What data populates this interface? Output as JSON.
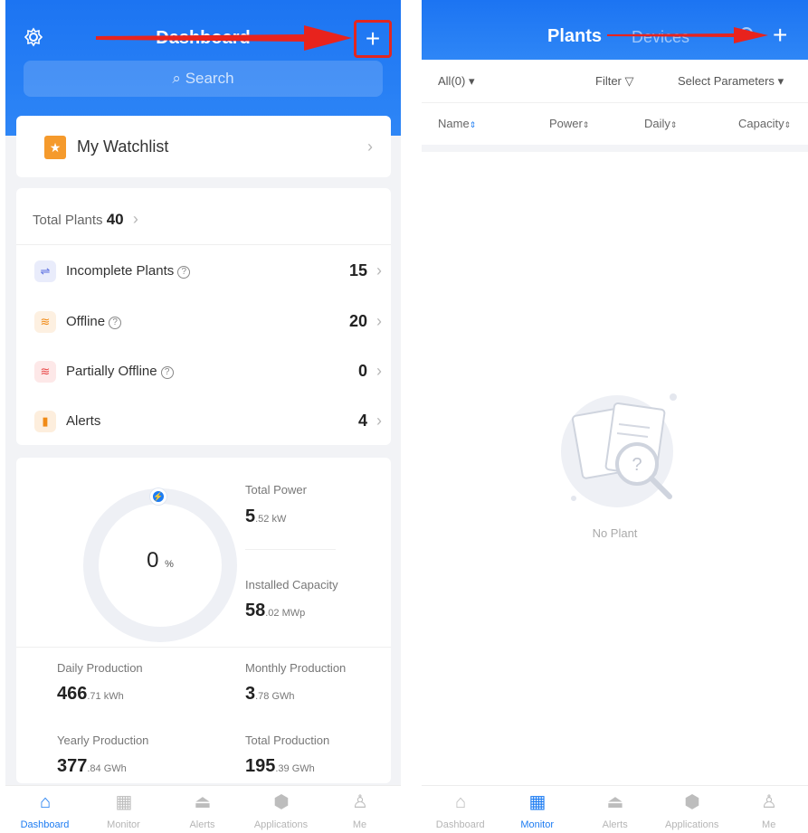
{
  "left": {
    "header": {
      "title": "Dashboard",
      "search_placeholder": "Search",
      "add_icon": "+",
      "settings_icon": "gear-icon"
    },
    "watchlist": {
      "label": "My Watchlist"
    },
    "plants": {
      "total_label": "Total Plants",
      "total_value": "40",
      "rows": [
        {
          "label": "Incomplete Plants",
          "value": "15",
          "icon": "plant-split-icon",
          "color": "#e9ecfb"
        },
        {
          "label": "Offline",
          "value": "20",
          "icon": "wifi-orange-icon",
          "color": "#fdf0e1"
        },
        {
          "label": "Partially Offline",
          "value": "0",
          "icon": "wifi-red-icon",
          "color": "#fde8e8"
        },
        {
          "label": "Alerts",
          "value": "4",
          "icon": "alert-icon",
          "color": "#fdeedd"
        }
      ]
    },
    "production": {
      "percent": "0",
      "percent_unit": "%",
      "total_power_label": "Total Power",
      "total_power_int": "5",
      "total_power_dec": ".52 kW",
      "installed_capacity_label": "Installed Capacity",
      "installed_capacity_int": "58",
      "installed_capacity_dec": ".02 MWp",
      "daily_label": "Daily Production",
      "daily_int": "466",
      "daily_dec": ".71 kWh",
      "monthly_label": "Monthly Production",
      "monthly_int": "3",
      "monthly_dec": ".78 GWh",
      "yearly_label": "Yearly Production",
      "yearly_int": "377",
      "yearly_dec": ".84 GWh",
      "total_label": "Total Production",
      "total_int": "195",
      "total_dec": ".39 GWh"
    },
    "tabbar": [
      {
        "label": "Dashboard",
        "icon": "home-icon",
        "active": true
      },
      {
        "label": "Monitor",
        "icon": "monitor-icon",
        "active": false
      },
      {
        "label": "Alerts",
        "icon": "siren-icon",
        "active": false
      },
      {
        "label": "Applications",
        "icon": "cube-icon",
        "active": false
      },
      {
        "label": "Me",
        "icon": "person-icon",
        "active": false
      }
    ]
  },
  "right": {
    "header": {
      "title": "Plants",
      "tab2": "Devices",
      "add_icon": "+"
    },
    "filters": {
      "all": "All(0)",
      "filter": "Filter",
      "select_params": "Select Parameters"
    },
    "columns": [
      "Name",
      "Power",
      "Daily",
      "Capacity"
    ],
    "empty_text": "No Plant",
    "tabbar": [
      {
        "label": "Dashboard",
        "icon": "home-icon",
        "active": false
      },
      {
        "label": "Monitor",
        "icon": "monitor-icon",
        "active": true
      },
      {
        "label": "Alerts",
        "icon": "siren-icon",
        "active": false
      },
      {
        "label": "Applications",
        "icon": "cube-icon",
        "active": false
      },
      {
        "label": "Me",
        "icon": "person-icon",
        "active": false
      }
    ]
  },
  "colors": {
    "brand": "#1d7cf2",
    "highlight": "#e3261f"
  }
}
